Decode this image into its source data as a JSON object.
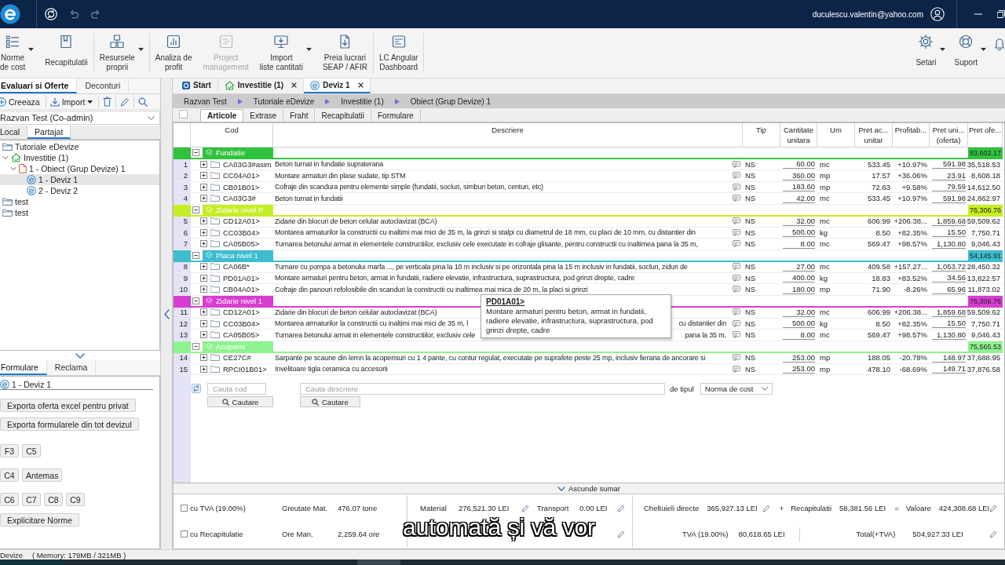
{
  "title_bar": {
    "user_email": "duculescu.valentin@yahoo.com"
  },
  "ribbon": {
    "groups": [
      [
        {
          "label": "Norme\nde cost",
          "menu": true,
          "disabled": false
        },
        {
          "label": "Recapitulatii",
          "menu": false,
          "disabled": false
        }
      ],
      [
        {
          "label": "Resursele\nproprii",
          "menu": true,
          "disabled": false
        }
      ],
      [
        {
          "label": "Analiza de\nprofit",
          "menu": false,
          "disabled": false
        },
        {
          "label": "Project\nmanagement",
          "menu": false,
          "disabled": true
        },
        {
          "label": "Import\nliste cantitati",
          "menu": true,
          "disabled": false
        },
        {
          "label": "Preia lucrari\nSEAP / AFIR",
          "menu": false,
          "disabled": false
        }
      ],
      [
        {
          "label": "LC Angular\nDashboard",
          "menu": false,
          "disabled": false
        }
      ]
    ],
    "right": [
      {
        "label": "Setari",
        "menu": true
      },
      {
        "label": "Suport",
        "menu": true
      }
    ]
  },
  "left_panel": {
    "tabs": [
      {
        "label": "Evaluari si Oferte",
        "selected": true
      },
      {
        "label": "Deconturi",
        "selected": false
      }
    ],
    "actions": [
      {
        "label": "Creeaza",
        "menu": false
      },
      {
        "label": "Import",
        "menu": true
      }
    ],
    "account_select": {
      "value": "Razvan Test (Co-admin)"
    },
    "scope_tabs": [
      {
        "label": "Local",
        "selected": false
      },
      {
        "label": "Partajat",
        "selected": true
      }
    ],
    "tree": [
      {
        "label": "Tutoriale eDevize",
        "kind": "folder",
        "selected": false
      },
      {
        "label": "Investitie (1)",
        "kind": "investment",
        "selected": false,
        "expanded": true,
        "children": [
          {
            "label": "1 - Obiect (Grup Devize) 1",
            "kind": "object",
            "selected": false,
            "expanded": true,
            "children": [
              {
                "label": "1 - Deviz 1",
                "kind": "estimate",
                "selected": true
              },
              {
                "label": "2 - Deviz 2",
                "kind": "estimate",
                "selected": false
              }
            ]
          }
        ]
      },
      {
        "label": "test",
        "kind": "folder",
        "selected": false
      },
      {
        "label": "test",
        "kind": "folder",
        "selected": false
      }
    ]
  },
  "forms_panel": {
    "tabs": [
      {
        "label": "Formulare",
        "selected": true
      },
      {
        "label": "Reclama",
        "selected": false
      }
    ],
    "document": "1 - Deviz 1",
    "button_rows": [
      [
        "Exporta oferta excel pentru privat"
      ],
      [
        "Exporta formularele din tot devizul"
      ],
      [
        "F3",
        "C5"
      ],
      [
        "C4",
        "Antemas"
      ],
      [
        "C6",
        "C7",
        "C8",
        "C9"
      ],
      [
        "Explicitare Norme"
      ]
    ]
  },
  "estimate": {
    "doc_tabs": [
      {
        "label": "Start",
        "kind": "start",
        "closable": false,
        "selected": false
      },
      {
        "label": "Investitie (1)",
        "kind": "investment",
        "closable": true,
        "selected": false
      },
      {
        "label": "Deviz 1",
        "kind": "estimate",
        "closable": true,
        "selected": true
      }
    ],
    "breadcrumb": [
      "Razvan Test",
      "Tutoriale eDevize",
      "Investitie (1)",
      "Obiect (Grup Devize) 1"
    ],
    "header_checkbox": {
      "checked": false
    },
    "sub_tabs": [
      {
        "label": "Articole",
        "selected": true
      },
      {
        "label": "Extrase",
        "selected": false
      },
      {
        "label": "Fraht",
        "selected": false
      },
      {
        "label": "Recapitulatii",
        "selected": false
      },
      {
        "label": "Formulare",
        "selected": false
      }
    ],
    "table": {
      "columns": [
        "Cod",
        "Descriere",
        "Tip",
        "Cantitate\nunitara",
        "Um",
        "Pret ac...\nunitar",
        "Profitab...",
        "Pret uni...\n(oferta)",
        "Pret ofe..."
      ],
      "rows": [
        {
          "kind": "group",
          "name": "Fundatie",
          "color": "#31c23d",
          "total": "83,602.17",
          "expanded": true
        },
        {
          "kind": "item",
          "number": "1",
          "code": "CA03G3#asim",
          "description": "Beton turnat in fundatie supraterana",
          "tip": "NS",
          "quantity": "60.00",
          "unit": "mc",
          "cost_price": "533.45",
          "profit": "+10.97%",
          "unit_price": "591.98",
          "total": "35,518.53",
          "expanded": false
        },
        {
          "kind": "item",
          "number": "2",
          "code": "CC04A01>",
          "description": "Montare armaturi din plase sudate, tip STM",
          "tip": "NS",
          "quantity": "360.00",
          "unit": "mp",
          "cost_price": "17.57",
          "profit": "+36.06%",
          "unit_price": "23.91",
          "total": "8,608.18",
          "expanded": false
        },
        {
          "kind": "item",
          "number": "3",
          "code": "CB01B01>",
          "description": "Cofraje din scandura pentru elemente simple (fundatii, socluri, simburi beton, centuri, etc)",
          "tip": "NS",
          "quantity": "183.60",
          "unit": "mp",
          "cost_price": "72.63",
          "profit": "+9.58%",
          "unit_price": "79.59",
          "total": "14,612.50",
          "expanded": false
        },
        {
          "kind": "item",
          "number": "4",
          "code": "CA03G3#",
          "description": "Beton turnat in fundatii",
          "tip": "NS",
          "quantity": "42.00",
          "unit": "mc",
          "cost_price": "533.45",
          "profit": "+10.97%",
          "unit_price": "591.98",
          "total": "24,862.97",
          "expanded": false
        },
        {
          "kind": "group",
          "name": "Zidarie nivel P",
          "color": "#c6ee24",
          "total": "76,306.76",
          "expanded": true
        },
        {
          "kind": "item",
          "number": "5",
          "code": "CD12A01>",
          "description": "Zidarie din blocuri de beton celular autoclavizat (BCA)",
          "tip": "NS",
          "quantity": "32.00",
          "unit": "mc",
          "cost_price": "606.99",
          "profit": "+206.38...",
          "unit_price": "1,859.68",
          "total": "59,509.62",
          "expanded": false
        },
        {
          "kind": "item",
          "number": "6",
          "code": "CC03B04>",
          "description": "Montarea armaturilor la constructii cu inaltimi mai mici de 35 m, la grinzi si stalpi cu diametrul de 18 mm, cu placi de 10 mm, cu distantier din",
          "tip": "NS",
          "quantity": "500.00",
          "unit": "kg",
          "cost_price": "8.50",
          "profit": "+82.35%",
          "unit_price": "15.50",
          "total": "7,750.71",
          "expanded": false
        },
        {
          "kind": "item",
          "number": "7",
          "code": "CA05B05>",
          "description": "Turnarea betonului armat in elementele constructiilor, exclusiv cele executate in cofraje glisante, pentru constructii cu inaltimea pana la 35 m,",
          "tip": "NS",
          "quantity": "8.00",
          "unit": "mc",
          "cost_price": "569.47",
          "profit": "+98.57%",
          "unit_price": "1,130.80",
          "total": "9,046.43",
          "expanded": false
        },
        {
          "kind": "group",
          "name": "Placa nivel 1",
          "color": "#3dbdcf",
          "total": "54,145.91",
          "expanded": true
        },
        {
          "kind": "item",
          "number": "8",
          "code": "CA06B*",
          "description": "Turnare cu pompa a betonului marfa ..., pe verticala pina la 10 m inclusiv si pe orizontala pina la 15 m inclusiv in fundatii, socluri, ziduri de",
          "tip": "NS",
          "quantity": "27.00",
          "unit": "mc",
          "cost_price": "409.58",
          "profit": "+157.27...",
          "unit_price": "1,053.72",
          "total": "28,450.32",
          "expanded": false
        },
        {
          "kind": "item",
          "number": "9",
          "code": "PD01A01>",
          "description": "Montare armaturi pentru beton, armat in fundatii, radiere elevatie, infrastructura, suprastructura, pod grinzi drepte, cadre",
          "tip": "NS",
          "quantity": "400.00",
          "unit": "kg",
          "cost_price": "18.83",
          "profit": "+83.52%",
          "unit_price": "34.56",
          "total": "13,822.57",
          "expanded": false
        },
        {
          "kind": "item",
          "number": "10",
          "code": "CB04A01>",
          "description": "Cofraje din panouri refolosibile din scanduri la constructii cu inaltimea mai mica de 20 m, la placi si grinzi",
          "tip": "NS",
          "quantity": "180.00",
          "unit": "mp",
          "cost_price": "71.90",
          "profit": "-8.26%",
          "unit_price": "65.96",
          "total": "11,873.02",
          "expanded": false
        },
        {
          "kind": "group",
          "name": "Zidarie nivel 1",
          "color": "#d63dd0",
          "total": "76,306.76",
          "expanded": true
        },
        {
          "kind": "item",
          "number": "11",
          "code": "CD12A01>",
          "description": "Zidarie din blocuri de beton celular autoclavizat (BCA)",
          "tip": "NS",
          "quantity": "32.00",
          "unit": "mc",
          "cost_price": "606.99",
          "profit": "+206.38...",
          "unit_price": "1,859.68",
          "total": "59,509.62",
          "expanded": false
        },
        {
          "kind": "item",
          "number": "12",
          "code": "CC03B04>",
          "description": "Montarea armaturilor la constructii cu inaltimi mai mici de 35 m, l",
          "description_end": "cu distantier din",
          "tip": "NS",
          "quantity": "500.00",
          "unit": "kg",
          "cost_price": "8.50",
          "profit": "+82.35%",
          "unit_price": "15.50",
          "total": "7,750.71",
          "expanded": false
        },
        {
          "kind": "item",
          "number": "13",
          "code": "CA05B05>",
          "description": "Turnarea betonului armat in elementele constructiilor, exclusiv cele",
          "description_end": "pana la 35 m,",
          "tip": "NS",
          "quantity": "8.00",
          "unit": "mc",
          "cost_price": "569.47",
          "profit": "+98.57%",
          "unit_price": "1,130.80",
          "total": "9,046.43",
          "expanded": false
        },
        {
          "kind": "group",
          "name": "Acoperis",
          "color": "#8ff38f",
          "total": "75,565.53",
          "expanded": true
        },
        {
          "kind": "item",
          "number": "14",
          "code": "CE27C#",
          "description": "Sarpante pe scaune din lemn la acoperisuri cu 1 4 pante, cu contur regulat, executate pe suprafete peste 25 mp, inclusiv fieraria de ancorare si",
          "tip": "NS",
          "quantity": "253.00",
          "unit": "mp",
          "cost_price": "188.05",
          "profit": "-20.78%",
          "unit_price": "148.97",
          "total": "37,688.95",
          "expanded": false
        },
        {
          "kind": "item",
          "number": "15",
          "code": "RPCI01B01>",
          "description": "Invelitoare tigla ceramica cu accesorii",
          "tip": "NS",
          "quantity": "253.00",
          "unit": "mp",
          "cost_price": "478.10",
          "profit": "-68.69%",
          "unit_price": "149.71",
          "total": "37,876.58",
          "expanded": false
        }
      ]
    },
    "tooltip": {
      "title": "PD01A01>",
      "text": "Montare armaturi pentru beton, armat in fundatii, radiere elevatie, infrastructura, suprastructura, pod grinzi drepte, cadre"
    },
    "search": {
      "code_field": {
        "placeholder": "Cauta cod"
      },
      "code_button": "Cautare",
      "description_field": {
        "placeholder": "Cauta descriere"
      },
      "description_button": "Cautare",
      "type_label": "de tipul",
      "type_select": {
        "value": "Norma de cost"
      }
    },
    "summary_toggle": "Ascunde sumar",
    "summary": {
      "options": [
        {
          "label": "cu TVA (19.00%)",
          "checked": false
        },
        {
          "label": "cu Recapitulatie",
          "checked": false
        }
      ],
      "quantities": [
        {
          "label": "Greutate Mat.",
          "value": "476.07 tone"
        },
        {
          "label": "Ore Man.",
          "value": "2,259.64 ore"
        }
      ],
      "costs": [
        {
          "label": "Material",
          "value": "276,521.30 LEI"
        },
        {
          "label": "Transport",
          "value": "0.00 LEI"
        }
      ],
      "direct_costs": {
        "label": "Cheltuieli directe",
        "value": "365,927.13 LEI"
      },
      "plus": "+",
      "recap": {
        "label": "Recapitulatii",
        "value": "58,381.56 LEI"
      },
      "equals": "=",
      "value": {
        "label": "Valoare",
        "value": "424,308.68 LEI"
      },
      "vat": {
        "label": "TVA (19.00%)",
        "value": "80,618.65 LEI"
      },
      "total": {
        "label": "Total(+TVA)",
        "value": "504,927.33 LEI"
      }
    },
    "video_caption": "automată și vă vor"
  },
  "status_bar": {
    "module": "Devize",
    "memory": "( Memory: 179MB / 321MB )"
  }
}
